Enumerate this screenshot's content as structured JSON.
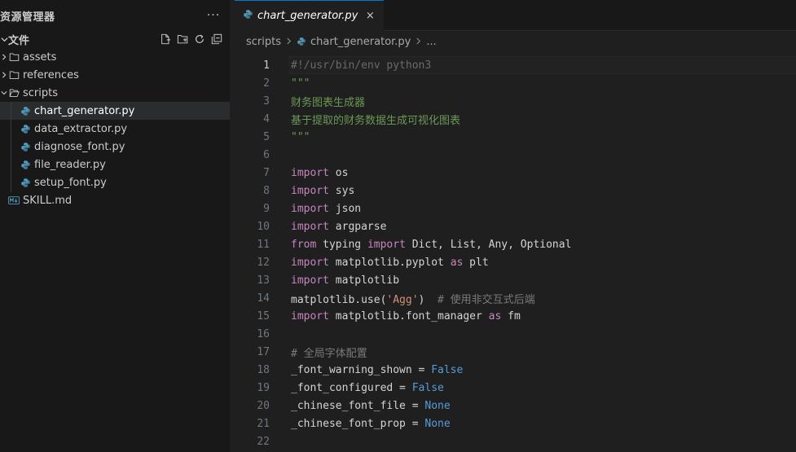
{
  "sidebar": {
    "title": "资源管理器",
    "more": "···",
    "section_title": "文件",
    "items": [
      {
        "label": "assets",
        "type": "folder",
        "expanded": false,
        "depth": 1
      },
      {
        "label": "references",
        "type": "folder",
        "expanded": false,
        "depth": 1
      },
      {
        "label": "scripts",
        "type": "folder",
        "expanded": true,
        "depth": 1
      },
      {
        "label": "chart_generator.py",
        "type": "python",
        "depth": 2,
        "selected": true
      },
      {
        "label": "data_extractor.py",
        "type": "python",
        "depth": 2
      },
      {
        "label": "diagnose_font.py",
        "type": "python",
        "depth": 2
      },
      {
        "label": "file_reader.py",
        "type": "python",
        "depth": 2
      },
      {
        "label": "setup_font.py",
        "type": "python",
        "depth": 2
      },
      {
        "label": "SKILL.md",
        "type": "markdown",
        "depth": 1
      }
    ]
  },
  "tabs": [
    {
      "label": "chart_generator.py",
      "close": "×",
      "active": true
    }
  ],
  "breadcrumb": {
    "folder": "scripts",
    "file": "chart_generator.py",
    "more": "..."
  },
  "editor": {
    "current_line": 1,
    "lines": [
      {
        "n": "1",
        "tokens": [
          {
            "t": "#!/usr/bin/env python3",
            "c": "tk-shebang"
          }
        ]
      },
      {
        "n": "2",
        "tokens": [
          {
            "t": "\"\"\"",
            "c": "tk-doc"
          }
        ]
      },
      {
        "n": "3",
        "tokens": [
          {
            "t": "财务图表生成器",
            "c": "tk-doc"
          }
        ]
      },
      {
        "n": "4",
        "tokens": [
          {
            "t": "基于提取的财务数据生成可视化图表",
            "c": "tk-doc"
          }
        ]
      },
      {
        "n": "5",
        "tokens": [
          {
            "t": "\"\"\"",
            "c": "tk-doc"
          }
        ]
      },
      {
        "n": "6",
        "tokens": []
      },
      {
        "n": "7",
        "tokens": [
          {
            "t": "import",
            "c": "tk-kw"
          },
          {
            "t": " os",
            "c": "tk-plain"
          }
        ]
      },
      {
        "n": "8",
        "tokens": [
          {
            "t": "import",
            "c": "tk-kw"
          },
          {
            "t": " sys",
            "c": "tk-plain"
          }
        ]
      },
      {
        "n": "9",
        "tokens": [
          {
            "t": "import",
            "c": "tk-kw"
          },
          {
            "t": " json",
            "c": "tk-plain"
          }
        ]
      },
      {
        "n": "10",
        "tokens": [
          {
            "t": "import",
            "c": "tk-kw"
          },
          {
            "t": " argparse",
            "c": "tk-plain"
          }
        ]
      },
      {
        "n": "11",
        "tokens": [
          {
            "t": "from",
            "c": "tk-kw"
          },
          {
            "t": " typing ",
            "c": "tk-plain"
          },
          {
            "t": "import",
            "c": "tk-kw"
          },
          {
            "t": " Dict, List, Any, Optional",
            "c": "tk-plain"
          }
        ]
      },
      {
        "n": "12",
        "tokens": [
          {
            "t": "import",
            "c": "tk-kw"
          },
          {
            "t": " matplotlib.pyplot ",
            "c": "tk-plain"
          },
          {
            "t": "as",
            "c": "tk-kw"
          },
          {
            "t": " plt",
            "c": "tk-plain"
          }
        ]
      },
      {
        "n": "13",
        "tokens": [
          {
            "t": "import",
            "c": "tk-kw"
          },
          {
            "t": " matplotlib",
            "c": "tk-plain"
          }
        ]
      },
      {
        "n": "14",
        "tokens": [
          {
            "t": "matplotlib.use(",
            "c": "tk-plain"
          },
          {
            "t": "'Agg'",
            "c": "tk-str"
          },
          {
            "t": ")  ",
            "c": "tk-plain"
          },
          {
            "t": "# 使用非交互式后端",
            "c": "tk-cm"
          }
        ]
      },
      {
        "n": "15",
        "tokens": [
          {
            "t": "import",
            "c": "tk-kw"
          },
          {
            "t": " matplotlib.font_manager ",
            "c": "tk-plain"
          },
          {
            "t": "as",
            "c": "tk-kw"
          },
          {
            "t": " fm",
            "c": "tk-plain"
          }
        ]
      },
      {
        "n": "16",
        "tokens": []
      },
      {
        "n": "17",
        "tokens": [
          {
            "t": "# 全局字体配置",
            "c": "tk-cm"
          }
        ]
      },
      {
        "n": "18",
        "tokens": [
          {
            "t": "_font_warning_shown = ",
            "c": "tk-plain"
          },
          {
            "t": "False",
            "c": "tk-const"
          }
        ]
      },
      {
        "n": "19",
        "tokens": [
          {
            "t": "_font_configured = ",
            "c": "tk-plain"
          },
          {
            "t": "False",
            "c": "tk-const"
          }
        ]
      },
      {
        "n": "20",
        "tokens": [
          {
            "t": "_chinese_font_file = ",
            "c": "tk-plain"
          },
          {
            "t": "None",
            "c": "tk-const"
          }
        ]
      },
      {
        "n": "21",
        "tokens": [
          {
            "t": "_chinese_font_prop = ",
            "c": "tk-plain"
          },
          {
            "t": "None",
            "c": "tk-const"
          }
        ]
      },
      {
        "n": "22",
        "tokens": []
      }
    ]
  },
  "colors": {
    "accent": "#0078d4",
    "python_icon": "#519aba",
    "markdown_icon": "#519aba"
  }
}
